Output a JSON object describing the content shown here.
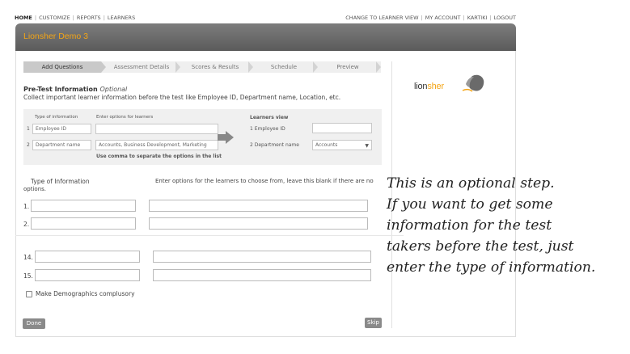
{
  "topnav": {
    "left": [
      "HOME",
      "CUSTOMIZE",
      "REPORTS",
      "LEARNERS"
    ],
    "right": [
      "CHANGE TO LEARNER VIEW",
      "MY ACCOUNT",
      "KARTIKI",
      "LOGOUT"
    ]
  },
  "header": {
    "title": "Lionsher Demo 3"
  },
  "steps": [
    "Add Questions",
    "Assessment Details",
    "Scores & Results",
    "Schedule",
    "Preview"
  ],
  "logo": {
    "text_prefix": "lion",
    "text_suffix": "sher"
  },
  "pretest": {
    "title": "Pre-Test Information",
    "optional_label": "Optional",
    "description": "Collect important learner information before the test like Employee ID, Department name, Location, etc."
  },
  "example": {
    "type_header": "Type of information",
    "options_header": "Enter options for learners",
    "rows": [
      {
        "num": "1",
        "type": "Employee ID",
        "options": ""
      },
      {
        "num": "2",
        "type": "Department name",
        "options": "Accounts, Business Development, Marketing"
      }
    ],
    "comma_hint": "Use comma to separate the options in the list",
    "learners_view": "Learners view",
    "learner_rows": [
      {
        "label": "1  Employee ID",
        "value": ""
      },
      {
        "label": "2  Department name",
        "value": "Accounts"
      }
    ]
  },
  "form": {
    "type_header": "Type of Information",
    "options_header": "Enter options for the learners to choose from, leave this blank if there are no",
    "options_header_cont": "options.",
    "rows": [
      {
        "num": "1."
      },
      {
        "num": "2."
      },
      {
        "num": "14."
      },
      {
        "num": "15."
      }
    ],
    "make_compulsory_label": "Make Demographics complusory",
    "done_label": "Done",
    "skip_label": "Skip"
  },
  "note": {
    "lines": [
      "This is an optional step.",
      "If you want to get some",
      "information for the test",
      "takers before the test, just",
      "enter the type of information."
    ]
  },
  "colors": {
    "accent": "#f4a516",
    "header_bg": "#6a6a6a",
    "button_bg": "#8a8a8a"
  }
}
